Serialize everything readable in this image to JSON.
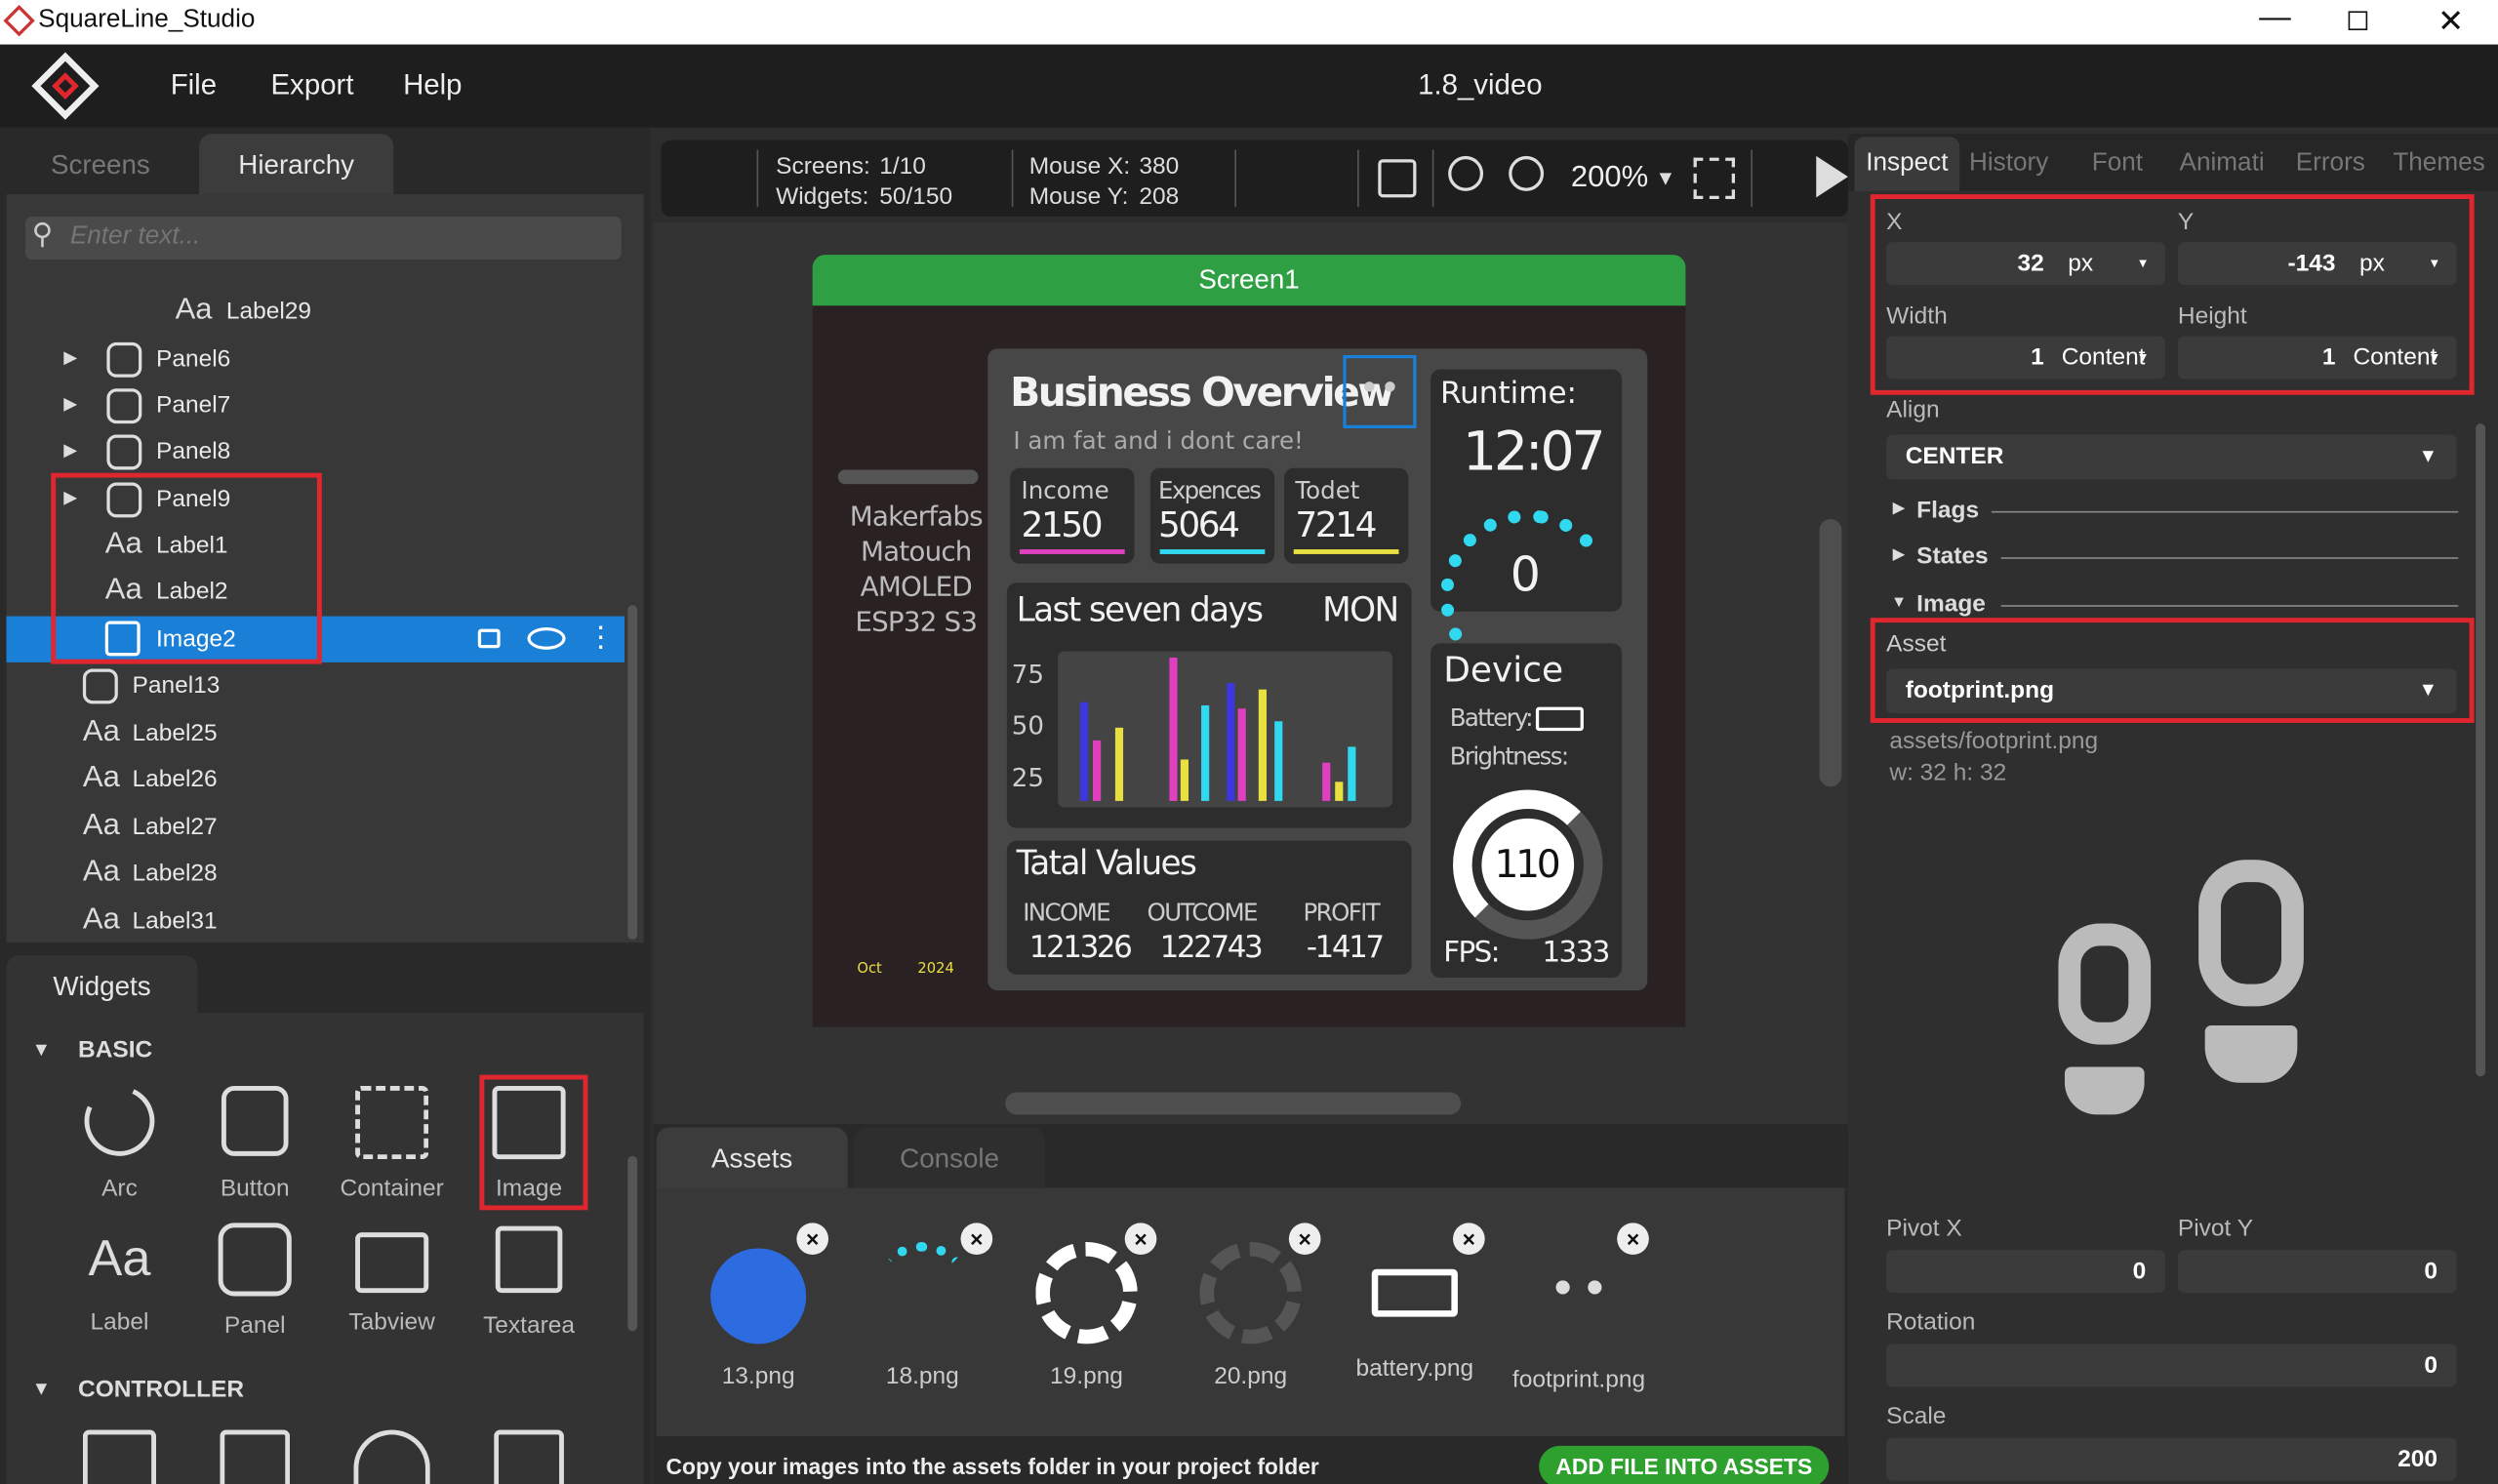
{
  "app": {
    "title": "SquareLine_Studio",
    "project": "1.8_video"
  },
  "menu": {
    "file": "File",
    "export": "Export",
    "help": "Help"
  },
  "left": {
    "tabs": [
      "Screens",
      "Hierarchy"
    ],
    "search_placeholder": "Enter text...",
    "tree": [
      "Label29",
      "Panel6",
      "Panel7",
      "Panel8",
      "Panel9",
      "Label1",
      "Label2",
      "Image2",
      "Panel13",
      "Label25",
      "Label26",
      "Label27",
      "Label28",
      "Label31"
    ],
    "widgets_tab": "Widgets",
    "basic": "BASIC",
    "controller": "CONTROLLER",
    "widgets": [
      "Arc",
      "Button",
      "Container",
      "Image",
      "Label",
      "Panel",
      "Tabview",
      "Textarea"
    ]
  },
  "toolbar": {
    "screens_label": "Screens:",
    "screens": "1/10",
    "widgets_label": "Widgets:",
    "widgets": "50/150",
    "mousex_label": "Mouse X:",
    "mousex": "380",
    "mousey_label": "Mouse Y:",
    "mousey": "208",
    "zoom": "200%"
  },
  "canvas": {
    "screen_name": "Screen1",
    "title": "Business Overview",
    "subtitle": "I am fat and i dont care!",
    "income_label": "Income",
    "income": "2150",
    "exp_label": "Expences",
    "exp": "5064",
    "total_label": "Todet",
    "total": "7214",
    "runtime_label": "Runtime:",
    "runtime": "12:07",
    "arc_value": "0",
    "left_info": [
      "Makerfabs",
      "Matouch",
      "AMOLED",
      "ESP32 S3"
    ],
    "date_month": "Oct",
    "date_year": "2024",
    "week_title": "Last seven days",
    "week_day": "MON",
    "y_ticks": [
      "75",
      "50",
      "25"
    ],
    "device_title": "Device",
    "battery_label": "Battery:",
    "bright_label": "Brightness:",
    "bright_value": "110",
    "fps_label": "FPS:",
    "fps": "1333",
    "totals_title": "Tatal Values",
    "t_income_l": "INCOME",
    "t_income": "121326",
    "t_outcome_l": "OUTCOME",
    "t_outcome": "122743",
    "t_profit_l": "PROFIT",
    "t_profit": "-1417"
  },
  "bottom": {
    "tabs": [
      "Assets",
      "Console"
    ],
    "assets": [
      "13.png",
      "18.png",
      "19.png",
      "20.png",
      "battery.png",
      "footprint.png"
    ],
    "hint": "Copy your images into the assets folder in your project folder",
    "add_button": "ADD FILE INTO ASSETS"
  },
  "right": {
    "tabs": [
      "Inspect",
      "History",
      "Font",
      "Animati",
      "Errors",
      "Themes"
    ],
    "x_label": "X",
    "x": "32",
    "x_unit": "px",
    "y_label": "Y",
    "y": "-143",
    "y_unit": "px",
    "w_label": "Width",
    "w": "1",
    "w_unit": "Content",
    "h_label": "Height",
    "h": "1",
    "h_unit": "Content",
    "align_label": "Align",
    "align": "CENTER",
    "flags": "Flags",
    "states": "States",
    "image": "Image",
    "asset_label": "Asset",
    "asset": "footprint.png",
    "asset_path": "assets/footprint.png",
    "asset_size": "w: 32  h: 32",
    "pivotx_label": "Pivot X",
    "pivotx": "0",
    "pivoty_label": "Pivot Y",
    "pivoty": "0",
    "rotation_label": "Rotation",
    "rotation": "0",
    "scale_label": "Scale",
    "scale": "200"
  },
  "colors": {
    "accent": "#1a7fd6",
    "green": "#2ea043",
    "red": "#e0262e",
    "add_button": "#2ea02e"
  }
}
